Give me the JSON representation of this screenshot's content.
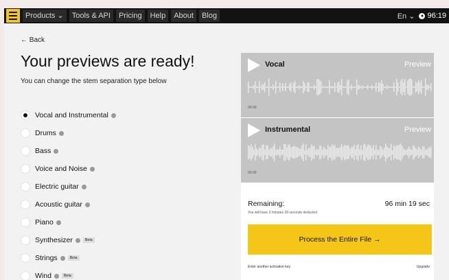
{
  "nav": {
    "items": [
      "Products",
      "Tools & API",
      "Pricing",
      "Help",
      "About",
      "Blog"
    ],
    "language": "En",
    "timer": "96:19"
  },
  "page": {
    "back": "← Back",
    "title": "Your previews are ready!",
    "subtitle": "You can change the stem separation type below"
  },
  "options": [
    {
      "label": "Vocal and Instrumental",
      "selected": true,
      "beta": ""
    },
    {
      "label": "Drums",
      "selected": false,
      "beta": ""
    },
    {
      "label": "Bass",
      "selected": false,
      "beta": ""
    },
    {
      "label": "Voice and Noise",
      "selected": false,
      "beta": ""
    },
    {
      "label": "Electric guitar",
      "selected": false,
      "beta": ""
    },
    {
      "label": "Acoustic guitar",
      "selected": false,
      "beta": ""
    },
    {
      "label": "Piano",
      "selected": false,
      "beta": ""
    },
    {
      "label": "Synthesizer",
      "selected": false,
      "beta": "Beta"
    },
    {
      "label": "Strings",
      "selected": false,
      "beta": "Beta"
    },
    {
      "label": "Wind",
      "selected": false,
      "beta": "Beta"
    }
  ],
  "tracks": [
    {
      "name": "Vocal",
      "preview": "Preview",
      "time": "00:00"
    },
    {
      "name": "Instrumental",
      "preview": "Preview",
      "time": "00:00"
    }
  ],
  "remaining": {
    "label": "Remaining:",
    "value": "96 min 19 sec",
    "note": "You will have 3 minutes 39 seconds deducted"
  },
  "process_button": "Process the Entire File →",
  "activation_link": "Enter another activation key",
  "upgrade_link": "Upgrade",
  "colors": {
    "accent": "#f5c518",
    "navbar": "#121212",
    "waveform_bg": "#c4c4c4"
  }
}
